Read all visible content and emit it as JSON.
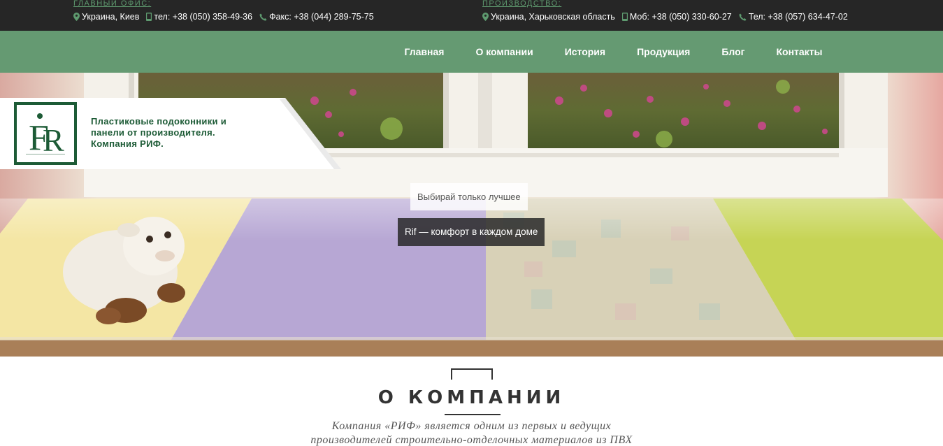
{
  "header": {
    "main_office": {
      "title": "ГЛАВНЫЙ ОФИС:",
      "location": "Украина, Киев",
      "phone": "тел: +38 (050) 358-49-36",
      "fax": "Факс: +38 (044) 289-75-75"
    },
    "production": {
      "title": "ПРОИЗВОДСТВО:",
      "location": "Украина, Харьковская область",
      "mobile": "Моб: +38 (050) 330-60-27",
      "phone": "Тел: +38 (057) 634-47-02"
    }
  },
  "brand": {
    "tagline": "Пластиковые подоконники и панели от производителя. Компания РИФ.",
    "primary_color": "#659a72",
    "dark_green": "#1d5b36"
  },
  "nav": {
    "items": [
      "Главная",
      "О компании",
      "История",
      "Продукция",
      "Блог",
      "Контакты"
    ]
  },
  "hero": {
    "slogan_1": "Выбирай только лучшее",
    "slogan_2": "Rif — комфорт в каждом доме"
  },
  "about": {
    "title": "О КОМПАНИИ",
    "text_line_1": "Компания «РИФ» является одним из первых и ведущих",
    "text_line_2": "производителей строительно-отделочных материалов из ПВХ"
  }
}
